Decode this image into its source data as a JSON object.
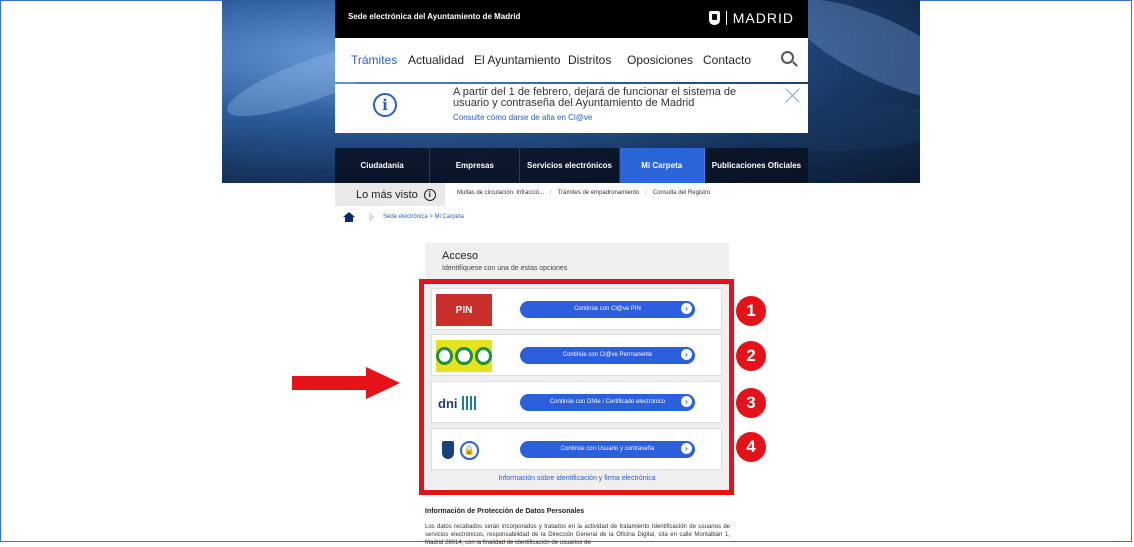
{
  "header": {
    "site_title": "Sede electrónica del Ayuntamiento de Madrid",
    "brand": "MADRID"
  },
  "main_nav": [
    "Trámites",
    "Actualidad",
    "El Ayuntamiento",
    "Distritos",
    "Oposiciones",
    "Contacto"
  ],
  "notice": {
    "message": "A partir del 1 de febrero, dejará de funcionar el sistema de usuario y contraseña del Ayuntamiento de Madrid",
    "link": "Consulte cómo darse de alta en Cl@ve"
  },
  "section_nav": [
    "Ciudadanía",
    "Empresas",
    "Servicios electrónicos",
    "Mi Carpeta",
    "Publicaciones Oficiales"
  ],
  "most_seen": {
    "label": "Lo más visto",
    "links": [
      "Multas de circulación. Infracció...",
      "Trámites de empadronamiento",
      "Consulta del Registro"
    ]
  },
  "breadcrumb": "Sede electrónica > Mi Carpeta",
  "access": {
    "title": "Acceso",
    "subtitle": "Identifíquese con una de estas opciones",
    "options": [
      {
        "label": "Continúe con Cl@ve PIN",
        "logo_text": "PIN"
      },
      {
        "label": "Continúe con Cl@ve Permanente"
      },
      {
        "label": "Continúe con DNIe / Certificado electrónico",
        "logo_text": "dni"
      },
      {
        "label": "Continúe con Usuario y contraseña"
      }
    ],
    "info_link": "Información sobre identificación y firma electrónica"
  },
  "badges": [
    "1",
    "2",
    "3",
    "4"
  ],
  "privacy": {
    "title": "Información de Protección de Datos Personales",
    "text": "Los datos recabados serán incorporados y tratados en la actividad de tratamiento Identificación de usuarios de servicios electrónicos, responsabilidad de la Dirección General de la Oficina Digital, sita en calle Montalbán 1, Madrid 28014, con la finalidad de identificación de usuarios de"
  },
  "colors": {
    "accent": "#2b5fde",
    "highlight": "#e5121a",
    "active_tab": "#2b66d8"
  }
}
